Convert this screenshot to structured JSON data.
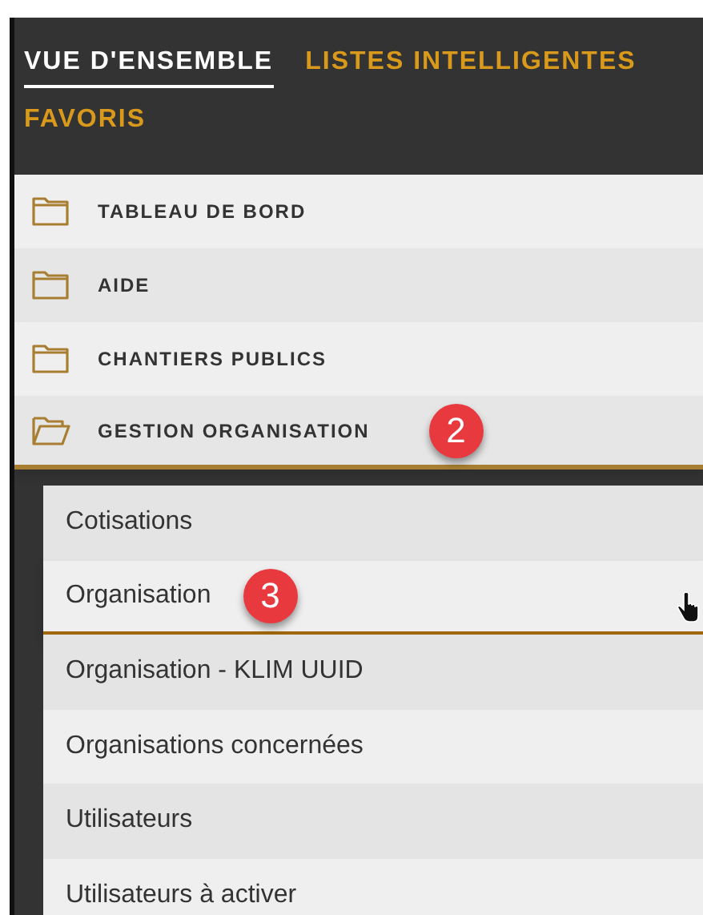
{
  "tabs": [
    {
      "label": "VUE D'ENSEMBLE",
      "selected": true
    },
    {
      "label": "LISTES INTELLIGENTES",
      "selected": false
    },
    {
      "label": "FAVORIS",
      "selected": false
    }
  ],
  "folders": [
    {
      "label": "TABLEAU DE BORD",
      "expanded": false
    },
    {
      "label": "AIDE",
      "expanded": false
    },
    {
      "label": "CHANTIERS PUBLICS",
      "expanded": false
    },
    {
      "label": "GESTION ORGANISATION",
      "expanded": true,
      "badge": "2",
      "children": [
        {
          "label": "Cotisations",
          "selected": false
        },
        {
          "label": "Organisation",
          "selected": true,
          "badge": "3"
        },
        {
          "label": "Organisation - KLIM UUID",
          "selected": false
        },
        {
          "label": "Organisations concernées",
          "selected": false
        },
        {
          "label": "Utilisateurs",
          "selected": false
        },
        {
          "label": "Utilisateurs à activer",
          "selected": false
        }
      ]
    }
  ]
}
